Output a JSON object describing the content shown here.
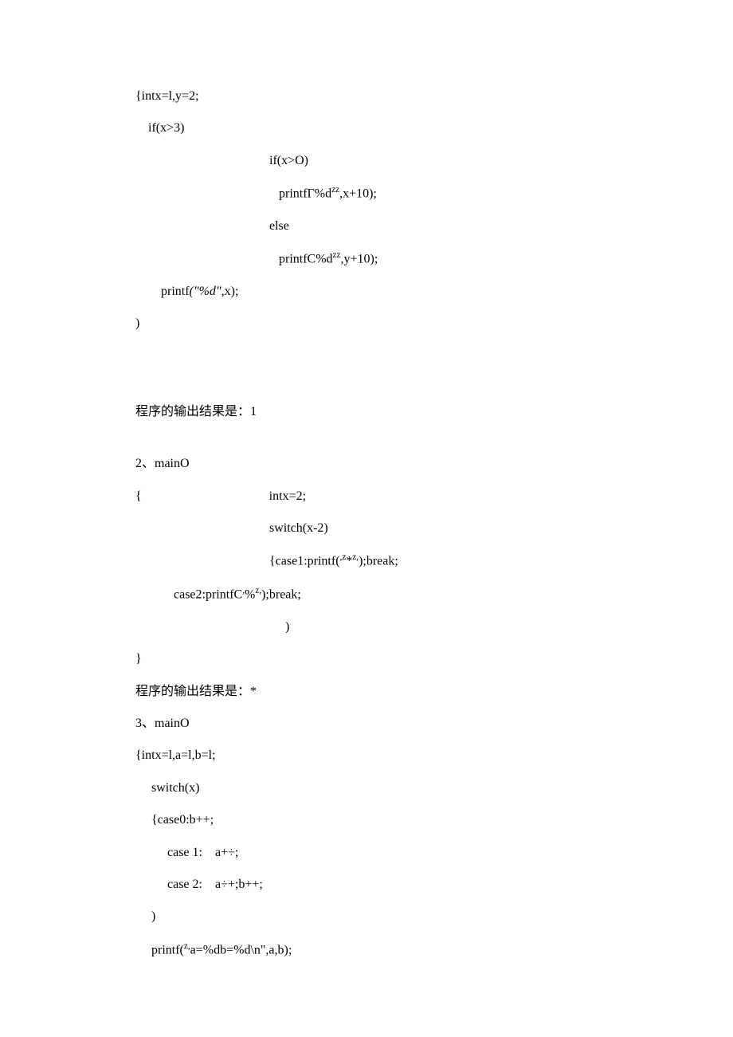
{
  "lines": {
    "l1": "{intx=l,y=2;",
    "l2": "    if(x>3)",
    "l3": "                                          if(x>O)",
    "l4_pre": "                                             printfΓ%d",
    "l4_sup": "zz",
    "l4_post": ",x+10);",
    "l5": "                                          else",
    "l6_pre": "                                             printfC%d",
    "l6_sup": "zz",
    "l6_post": ",y+10);",
    "l7_pre": "        printf",
    "l7_italic": "(\"%d\",",
    "l7_post": "x);",
    "l8": ")",
    "l9": "程序的输出结果是：1",
    "l10": "2、mainO",
    "l11": "{                                        intx=2;",
    "l12": "                                          switch(x-2)",
    "l13_pre": "                                          {case1:printf(",
    "l13_sup1": ",z",
    "l13_mid": "*",
    "l13_sup2": "z,",
    "l13_post": ");break;",
    "l14_pre": "            case2:printfC",
    "l14_sup1": ",",
    "l14_mid": "%",
    "l14_sup2": "z,",
    "l14_post": ");break;",
    "l15": "                                               )",
    "l16": "}",
    "l17": "程序的输出结果是：*",
    "l18": "3、mainO",
    "l19": "{intx=l,a=l,b=l;",
    "l20": "     switch(x)",
    "l21": "     {case0:b++;",
    "l22": "          case 1:    a+÷;",
    "l23": "          case 2:    a÷+;b++;",
    "l24": "     )",
    "l25_pre": "     printf(",
    "l25_sup": "z,",
    "l25_mid": "a=%db=%d\\n",
    "l25_post": "\",a,b);"
  }
}
